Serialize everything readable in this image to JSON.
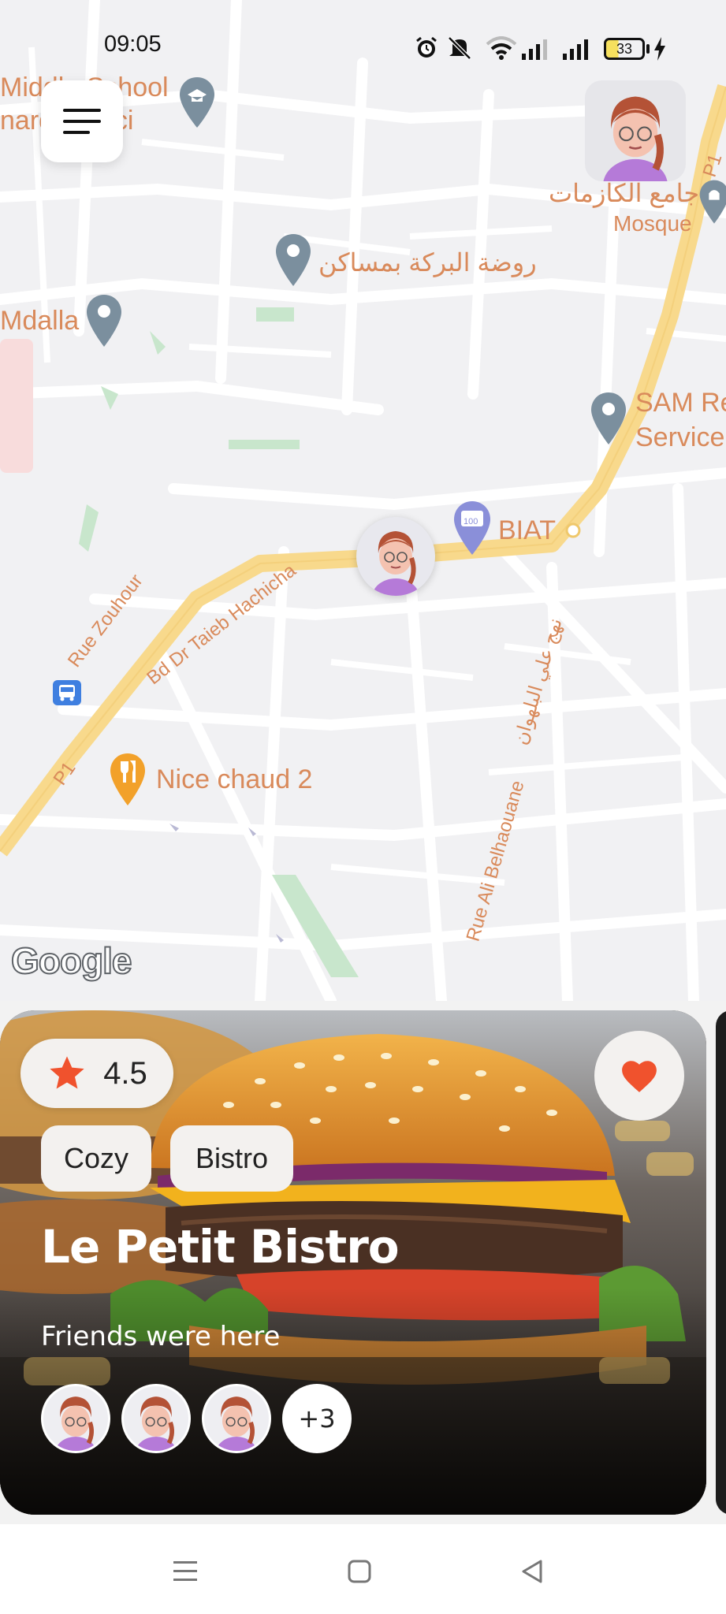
{
  "status_bar": {
    "time": "09:05",
    "battery": "33"
  },
  "map": {
    "labels": {
      "middle_school_1": "Middle School",
      "middle_school_2": "nardo Vinci",
      "mosque_ar": "جامع الكازمات",
      "mosque_en": "Mosque",
      "kindergarten_ar": "روضة البركة بمساكن",
      "mdalla": "Mdalla",
      "sam_1": "SAM Re",
      "sam_2": "Service",
      "biat": "BIAT",
      "rue_zouhour": "Rue Zouhour",
      "bd_taieb": "Bd Dr Taieb Hachicha",
      "p1_top": "P1",
      "p1_bottom": "P1",
      "nice_chaud": "Nice chaud 2",
      "rue_ali": "Rue Ali Belhaouane",
      "rue_ali_ar": "نهج علي البلهوان",
      "bank_badge": "100"
    },
    "google_logo": "Google",
    "colors": {
      "map_bg": "#f1f1f3",
      "road_major": "#f8d98c",
      "label": "#d98a5b",
      "pin": "#7b8f9e",
      "restaurant_pin": "#f2a12a"
    }
  },
  "icons": {
    "menu": "menu-icon",
    "avatar": "avatar-icon",
    "star": "star-icon",
    "heart": "heart-icon"
  },
  "card": {
    "rating": "4.5",
    "tags": [
      "Cozy",
      "Bistro"
    ],
    "title": "Le Petit Bistro",
    "subtitle": "Friends were here",
    "friends_more": "+3",
    "accent_color": "#f0522d"
  }
}
